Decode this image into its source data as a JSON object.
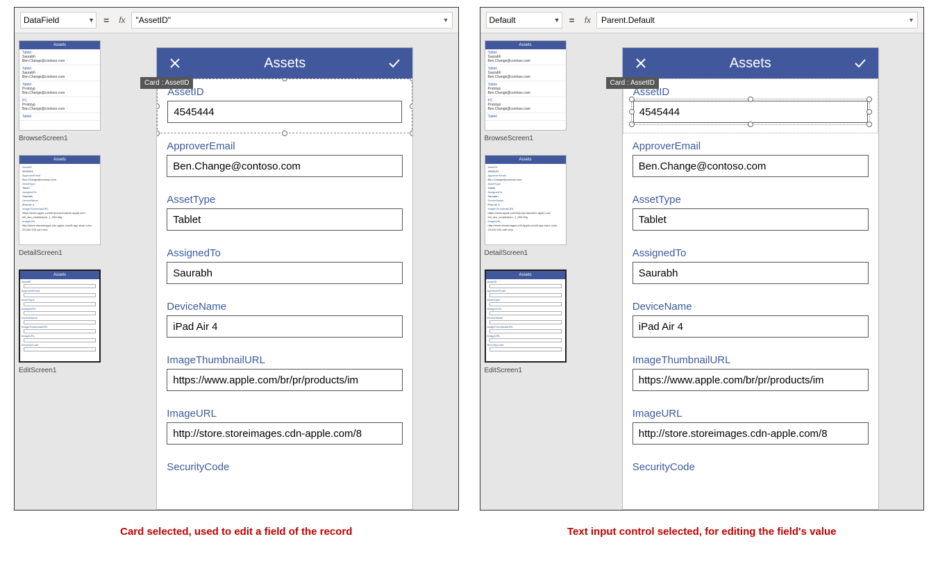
{
  "left": {
    "property": "DataField",
    "formula": "\"AssetID\"",
    "card_tag": "Card : AssetID",
    "phone_title": "Assets",
    "selection_mode": "card",
    "caption": "Card selected, used to edit a field of the record"
  },
  "right": {
    "property": "Default",
    "formula": "Parent.Default",
    "card_tag": "Card : AssetID",
    "phone_title": "Assets",
    "selection_mode": "input",
    "caption": "Text input control selected, for editing the field's value"
  },
  "screens": {
    "browse": "BrowseScreen1",
    "detail": "DetailScreen1",
    "edit": "EditScreen1"
  },
  "thumb_title": "Assets",
  "fields": [
    {
      "label": "AssetID",
      "value": "4545444"
    },
    {
      "label": "ApproverEmail",
      "value": "Ben.Change@contoso.com"
    },
    {
      "label": "AssetType",
      "value": "Tablet"
    },
    {
      "label": "AssignedTo",
      "value": "Saurabh"
    },
    {
      "label": "DeviceName",
      "value": "iPad Air 4"
    },
    {
      "label": "ImageThumbnailURL",
      "value": "https://www.apple.com/br/pr/products/im"
    },
    {
      "label": "ImageURL",
      "value": "http://store.storeimages.cdn-apple.com/8"
    },
    {
      "label": "SecurityCode",
      "value": ""
    }
  ]
}
